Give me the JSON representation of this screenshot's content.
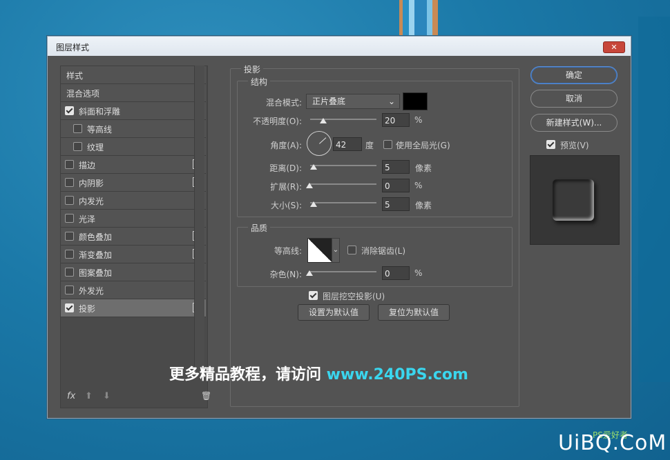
{
  "dialog": {
    "title": "图层样式",
    "close_glyph": "✕"
  },
  "styles_list": [
    {
      "label": "样式",
      "checkbox": false,
      "checked": false,
      "plus": false,
      "indent": false,
      "selected": false
    },
    {
      "label": "混合选项",
      "checkbox": false,
      "checked": false,
      "plus": false,
      "indent": false,
      "selected": false
    },
    {
      "label": "斜面和浮雕",
      "checkbox": true,
      "checked": true,
      "plus": false,
      "indent": false,
      "selected": false
    },
    {
      "label": "等高线",
      "checkbox": true,
      "checked": false,
      "plus": false,
      "indent": true,
      "selected": false
    },
    {
      "label": "纹理",
      "checkbox": true,
      "checked": false,
      "plus": false,
      "indent": true,
      "selected": false
    },
    {
      "label": "描边",
      "checkbox": true,
      "checked": false,
      "plus": true,
      "indent": false,
      "selected": false
    },
    {
      "label": "内阴影",
      "checkbox": true,
      "checked": false,
      "plus": true,
      "indent": false,
      "selected": false
    },
    {
      "label": "内发光",
      "checkbox": true,
      "checked": false,
      "plus": false,
      "indent": false,
      "selected": false
    },
    {
      "label": "光泽",
      "checkbox": true,
      "checked": false,
      "plus": false,
      "indent": false,
      "selected": false
    },
    {
      "label": "颜色叠加",
      "checkbox": true,
      "checked": false,
      "plus": true,
      "indent": false,
      "selected": false
    },
    {
      "label": "渐变叠加",
      "checkbox": true,
      "checked": false,
      "plus": true,
      "indent": false,
      "selected": false
    },
    {
      "label": "图案叠加",
      "checkbox": true,
      "checked": false,
      "plus": false,
      "indent": false,
      "selected": false
    },
    {
      "label": "外发光",
      "checkbox": true,
      "checked": false,
      "plus": false,
      "indent": false,
      "selected": false
    },
    {
      "label": "投影",
      "checkbox": true,
      "checked": true,
      "plus": true,
      "indent": false,
      "selected": true
    }
  ],
  "bottom_tools": {
    "fx": "fx",
    "up": "⬆",
    "down": "⬇",
    "trash": "🗑"
  },
  "drop_shadow": {
    "section_title": "投影",
    "structure": {
      "title": "结构",
      "blend_mode_label": "混合模式:",
      "blend_mode_value": "正片叠底",
      "color": "#000000",
      "opacity_label": "不透明度(O):",
      "opacity_value": "20",
      "opacity_unit": "%",
      "opacity_level": 20,
      "angle_label": "角度(A):",
      "angle_value": "42",
      "angle_unit": "度",
      "global_light_label": "使用全局光(G)",
      "global_light_checked": false,
      "distance_label": "距离(D):",
      "distance_value": "5",
      "distance_unit": "像素",
      "spread_label": "扩展(R):",
      "spread_value": "0",
      "spread_unit": "%",
      "size_label": "大小(S):",
      "size_value": "5",
      "size_unit": "像素"
    },
    "quality": {
      "title": "品质",
      "contour_label": "等高线:",
      "anti_alias_label": "消除锯齿(L)",
      "anti_alias_checked": false,
      "noise_label": "杂色(N):",
      "noise_value": "0",
      "noise_unit": "%"
    },
    "knockout_label": "图层挖空投影(U)",
    "knockout_checked": true,
    "make_default": "设置为默认值",
    "reset_default": "复位为默认值"
  },
  "actions": {
    "ok": "确定",
    "cancel": "取消",
    "new_style": "新建样式(W)...",
    "preview_label": "预览(V)",
    "preview_checked": true
  },
  "overlay": {
    "promo_text": "更多精品教程，请访问 ",
    "promo_url": "www.240PS.com",
    "corner_brand": "UiBQ.CoM",
    "corner_ps": "PS爱好者"
  }
}
